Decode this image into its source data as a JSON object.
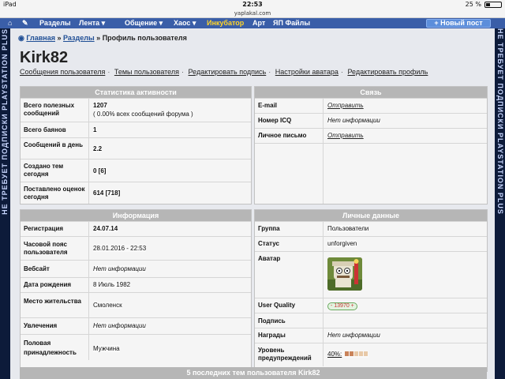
{
  "status_bar": {
    "device": "iPad",
    "time": "22:53",
    "battery": "25 %"
  },
  "browser": {
    "url": "yaplakal.com"
  },
  "nav": {
    "items": [
      "Разделы",
      "Лента ▾",
      "Общение ▾",
      "Хаос ▾",
      "Инкубатор",
      "Арт",
      "ЯП Файлы"
    ],
    "highlight_color": "#ffd42a",
    "new_post": "+ Новый пост"
  },
  "side_banner": {
    "text": "НЕ ТРЕБУЕТ ПОДПИСКИ PLAYSTATION PLUS"
  },
  "breadcrumb": {
    "home": "Главная",
    "sep1": "»",
    "sections": "Разделы",
    "sep2": "»",
    "current": "Профиль пользователя"
  },
  "profile": {
    "username": "Kirk82"
  },
  "profile_links": [
    "Сообщения пользователя",
    "Темы пользователя",
    "Редактировать подпись",
    "Настройки аватара",
    "Редактировать профиль"
  ],
  "stats": {
    "title": "Статистика активности",
    "rows": [
      {
        "label": "Всего полезных сообщений",
        "value": "1207",
        "sub": "( 0.00% всех сообщений форума )"
      },
      {
        "label": "Всего баянов",
        "value": "1"
      },
      {
        "label": "Сообщений в день",
        "value": "2.2"
      },
      {
        "label": "Создано тем сегодня",
        "value": "0 [6]"
      },
      {
        "label": "Поставлено оценок сегодня",
        "value": "614 [718]"
      }
    ]
  },
  "contact": {
    "title": "Связь",
    "rows": [
      {
        "label": "E-mail",
        "value": "Отправить"
      },
      {
        "label": "Номер ICQ",
        "value": "Нет информации"
      },
      {
        "label": "Личное письмо",
        "value": "Отправить"
      }
    ]
  },
  "info": {
    "title": "Информация",
    "rows": [
      {
        "label": "Регистрация",
        "value": "24.07.14"
      },
      {
        "label": "Часовой пояс пользователя",
        "value": "28.01.2016 - 22:53"
      },
      {
        "label": "Вебсайт",
        "value": "Нет информации"
      },
      {
        "label": "Дата рождения",
        "value": "8 Июль 1982"
      },
      {
        "label": "Место жительства",
        "value": "Смоленск"
      },
      {
        "label": "Увлечения",
        "value": "Нет информации"
      },
      {
        "label": "Половая принадлежность",
        "value": "Мужчина"
      }
    ]
  },
  "personal": {
    "title": "Личные данные",
    "rows": [
      {
        "label": "Группа",
        "value": "Пользователи"
      },
      {
        "label": "Статус",
        "value": "unforgiven"
      },
      {
        "label": "Аватар",
        "value": ""
      },
      {
        "label": "User Quality",
        "value": "- 13970 +"
      },
      {
        "label": "Подпись",
        "value": ""
      },
      {
        "label": "Награды",
        "value": "Нет информации"
      },
      {
        "label": "Уровень предупреждений",
        "value": "40%:"
      }
    ],
    "warning_level": 0.4
  },
  "bottom": {
    "title": "5 последних тем пользователя Kirk82"
  }
}
